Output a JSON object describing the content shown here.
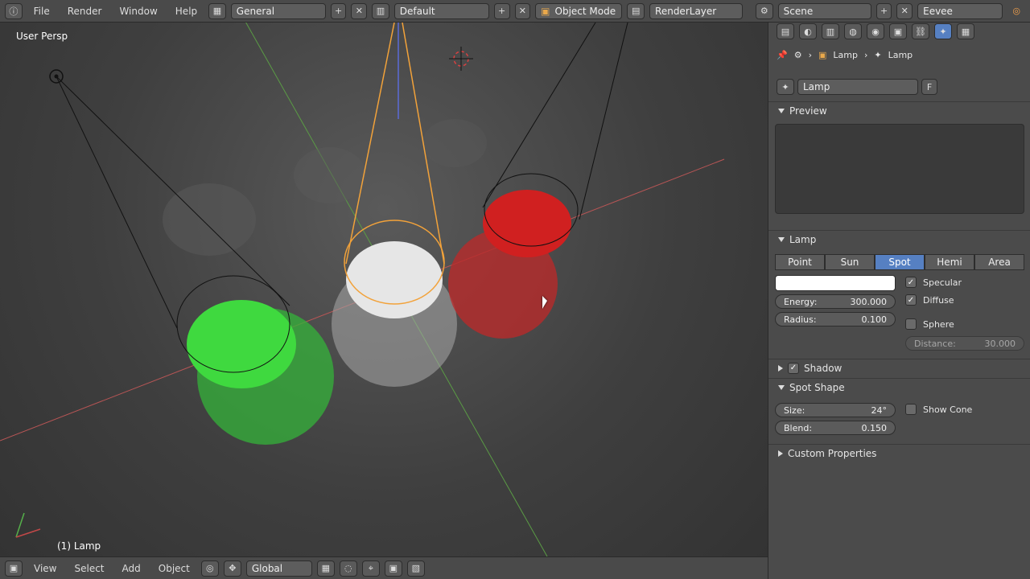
{
  "topbar": {
    "menu": [
      "File",
      "Render",
      "Window",
      "Help"
    ],
    "layout_label": "General",
    "screen_label": "Default",
    "mode_label": "Object Mode",
    "renderlayer_label": "RenderLayer",
    "scene_label": "Scene",
    "engine_label": "Eevee"
  },
  "viewport": {
    "view_label": "User Persp",
    "selected_object_label": "(1) Lamp"
  },
  "bottombar": {
    "menu": [
      "View",
      "Select",
      "Add",
      "Object"
    ],
    "orientation_label": "Global"
  },
  "properties": {
    "breadcrumb": [
      "Lamp",
      "Lamp"
    ],
    "datablock_name": "Lamp",
    "datablock_fake_user": "F",
    "preview_title": "Preview",
    "lamp_title": "Lamp",
    "lamp_types": [
      "Point",
      "Sun",
      "Spot",
      "Hemi",
      "Area"
    ],
    "lamp_active_type": "Spot",
    "energy_label": "Energy:",
    "energy_value": "300.000",
    "radius_label": "Radius:",
    "radius_value": "0.100",
    "specular_label": "Specular",
    "diffuse_label": "Diffuse",
    "sphere_label": "Sphere",
    "distance_label": "Distance:",
    "distance_value": "30.000",
    "shadow_title": "Shadow",
    "spot_shape_title": "Spot Shape",
    "size_label": "Size:",
    "size_value": "24°",
    "show_cone_label": "Show Cone",
    "blend_label": "Blend:",
    "blend_value": "0.150",
    "custom_props_title": "Custom Properties"
  },
  "colors": {
    "accent": "#5680c2",
    "panel_bg": "#4b4b4b",
    "viewport_bg": "#3d3d3d",
    "lamp_color": "#ffffff"
  }
}
